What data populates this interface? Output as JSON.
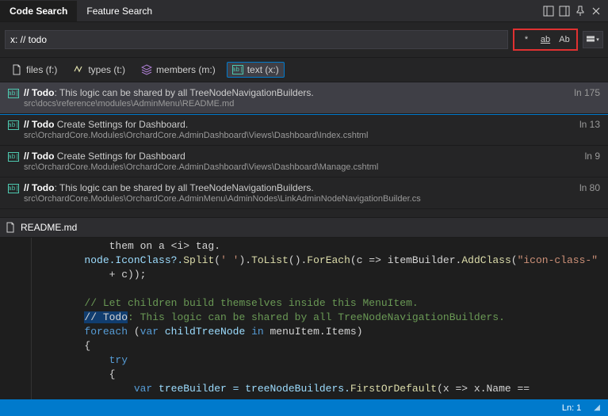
{
  "tabs": {
    "code_search": "Code Search",
    "feature_search": "Feature Search"
  },
  "search": {
    "value": "x: // todo"
  },
  "opts": {
    "wildcard": "*",
    "whole_word": "ab",
    "match_case": "Ab"
  },
  "filters": {
    "files": "files (f:)",
    "types": "types (t:)",
    "members": "members (m:)",
    "text": "text (x:)"
  },
  "results": [
    {
      "title_prefix": "// Todo",
      "title_rest": ": This logic can be shared by all TreeNodeNavigationBuilders.",
      "path": "src\\docs\\reference\\modules\\AdminMenu\\README.md",
      "ln": "ln 175"
    },
    {
      "title_prefix": "// Todo",
      "title_rest": " Create Settings for Dashboard.",
      "path": "src\\OrchardCore.Modules\\OrchardCore.AdminDashboard\\Views\\Dashboard\\Index.cshtml",
      "ln": "ln 13"
    },
    {
      "title_prefix": "// Todo",
      "title_rest": " Create Settings for Dashboard",
      "path": "src\\OrchardCore.Modules\\OrchardCore.AdminDashboard\\Views\\Dashboard\\Manage.cshtml",
      "ln": "ln 9"
    },
    {
      "title_prefix": "// Todo",
      "title_rest": ": This logic can be shared by all TreeNodeNavigationBuilders.",
      "path": "src\\OrchardCore.Modules\\OrchardCore.AdminMenu\\AdminNodes\\LinkAdminNodeNavigationBuilder.cs",
      "ln": "ln 80"
    }
  ],
  "open_file": "README.md",
  "code": {
    "l1": "            them on a <i> tag.",
    "l2a": "        node.IconClass?.",
    "l2m": "Split",
    "l2b": "(",
    "l2s": "' '",
    "l2c": ").",
    "l2m2": "ToList",
    "l2d": "().",
    "l2m3": "ForEach",
    "l2e": "(c => itemBuilder.",
    "l2m4": "AddClass",
    "l2f": "(",
    "l2s2": "\"icon-class-\"",
    "l3": "            + c));",
    "l4": "",
    "l5": "        // Let children build themselves inside this MenuItem.",
    "l6a": "        ",
    "l6hl": "// Todo",
    "l6b": ": This logic can be shared by all TreeNodeNavigationBuilders.",
    "l7a": "        foreach",
    "l7b": " (",
    "l7c": "var",
    "l7d": " childTreeNode ",
    "l7e": "in",
    "l7f": " menuItem.Items)",
    "l8": "        {",
    "l9a": "            try",
    "l10": "            {",
    "l11a": "                var",
    "l11b": " treeBuilder = treeNodeBuilders.",
    "l11m": "FirstOrDefault",
    "l11c": "(x => x.Name =="
  },
  "status": {
    "pos": "Ln: 1"
  }
}
